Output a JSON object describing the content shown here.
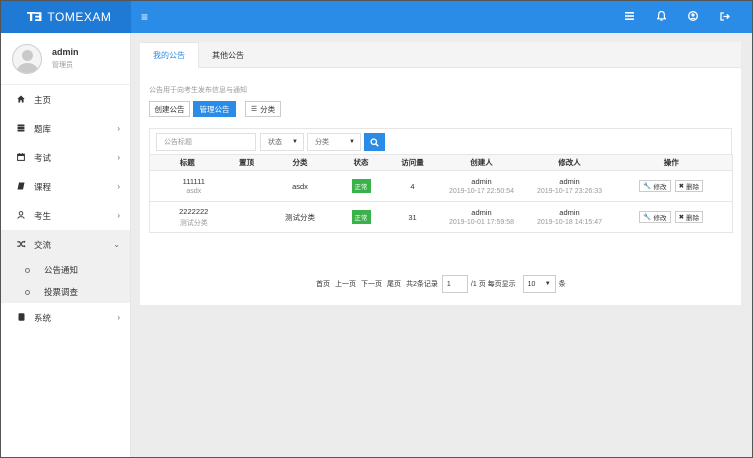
{
  "header": {
    "logo": "T∃",
    "brand": "TOMEXAM",
    "menu_toggle": "≡",
    "icons": [
      "list-icon",
      "bell-icon",
      "user-icon",
      "logout-icon"
    ]
  },
  "profile": {
    "name": "admin",
    "role": "管理员"
  },
  "sidebar": {
    "items": [
      {
        "label": "主页",
        "icon": "home-icon"
      },
      {
        "label": "题库",
        "icon": "database-icon",
        "chevron": "›"
      },
      {
        "label": "考试",
        "icon": "calendar-icon",
        "chevron": "›"
      },
      {
        "label": "课程",
        "icon": "book-icon",
        "chevron": "›"
      },
      {
        "label": "考生",
        "icon": "person-icon",
        "chevron": "›"
      },
      {
        "label": "交流",
        "icon": "shuffle-icon",
        "chevron": "⌄"
      },
      {
        "label": "系统",
        "icon": "server-icon",
        "chevron": "›"
      }
    ],
    "subitems": [
      {
        "label": "公告通知"
      },
      {
        "label": "投票调查"
      }
    ]
  },
  "tabs": [
    {
      "label": "我的公告"
    },
    {
      "label": "其他公告"
    }
  ],
  "hint": "公告用于向考生发布信息与通知",
  "buttons": {
    "create": "创建公告",
    "manage": "管理公告",
    "category": "分类"
  },
  "filters": {
    "title_placeholder": "公告标题",
    "status": "状态",
    "category": "分类"
  },
  "table": {
    "headers": [
      "标题",
      "置顶",
      "分类",
      "状态",
      "访问量",
      "创建人",
      "修改人",
      "操作"
    ],
    "rows": [
      {
        "title": "111111",
        "subtitle": "asdx",
        "top": "",
        "category": "asdx",
        "status": "正常",
        "views": "4",
        "creator": "admin",
        "created": "2019-10-17 22:50:54",
        "modifier": "admin",
        "modified": "2019-10-17 23:26:33",
        "edit": "修改",
        "delete": "删除"
      },
      {
        "title": "2222222",
        "subtitle": "测试分类",
        "top": "",
        "category": "测试分类",
        "status": "正常",
        "views": "31",
        "creator": "admin",
        "created": "2019-10-01 17:59:58",
        "modifier": "admin",
        "modified": "2019-10-18 14:15:47",
        "edit": "修改",
        "delete": "删除"
      }
    ]
  },
  "pager": {
    "first": "首页",
    "prev": "上一页",
    "next": "下一页",
    "last": "尾页",
    "total": "共2条记录",
    "page": "1",
    "page_info": "/1 页 每页显示",
    "page_size": "10",
    "unit": "条"
  },
  "colors": {
    "primary": "#2b8ce8",
    "success": "#3bb14a"
  }
}
